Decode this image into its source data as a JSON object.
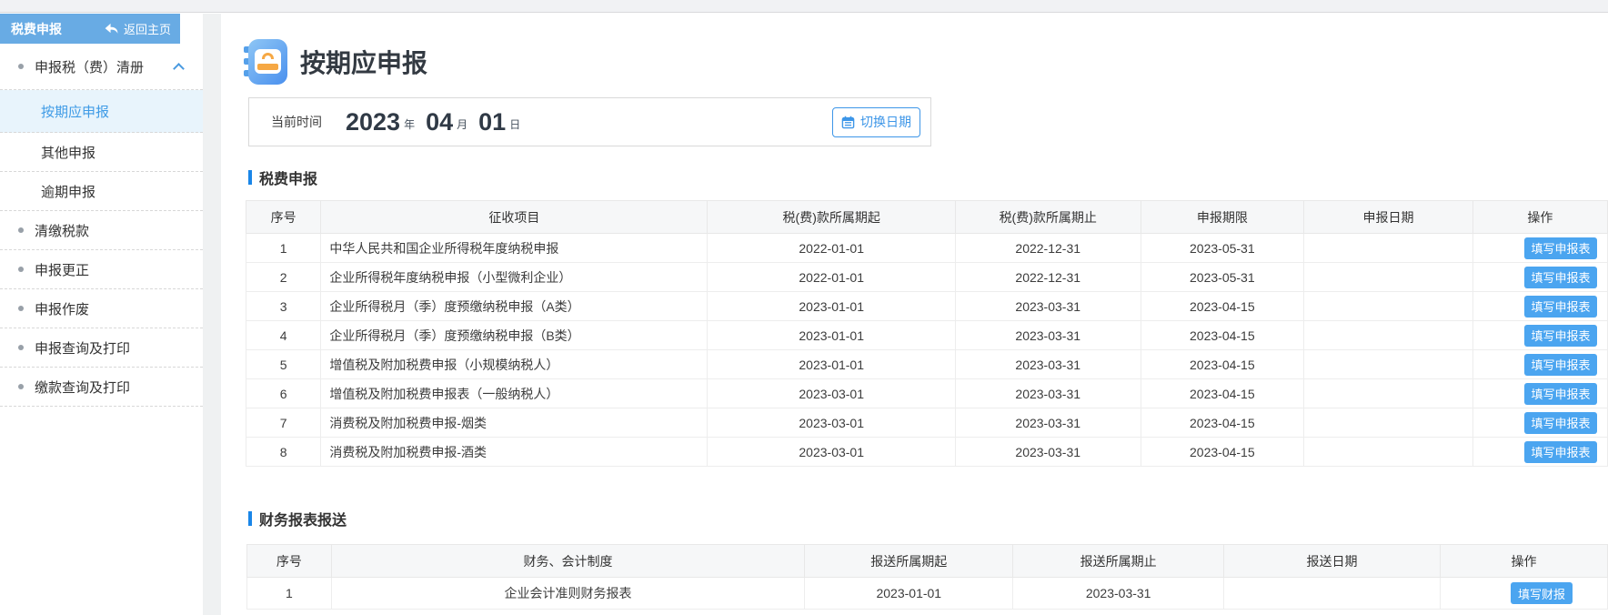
{
  "sidebar": {
    "header": {
      "title": "税费申报",
      "back_label": "返回主页"
    },
    "items": [
      {
        "type": "parent",
        "label": "申报税（费）清册",
        "expanded": true
      },
      {
        "type": "sub",
        "label": "按期应申报",
        "active": true
      },
      {
        "type": "sub",
        "label": "其他申报"
      },
      {
        "type": "sub",
        "label": "逾期申报"
      },
      {
        "type": "parent",
        "label": "清缴税款"
      },
      {
        "type": "parent",
        "label": "申报更正"
      },
      {
        "type": "parent",
        "label": "申报作废"
      },
      {
        "type": "parent",
        "label": "申报查询及打印"
      },
      {
        "type": "parent",
        "label": "缴款查询及打印"
      }
    ]
  },
  "main": {
    "page_title": "按期应申报",
    "date_bar": {
      "label": "当前时间",
      "year": "2023",
      "year_unit": "年",
      "month": "04",
      "month_unit": "月",
      "day": "01",
      "day_unit": "日",
      "switch_button": "切换日期"
    },
    "tax_table": {
      "section_title": "税费申报",
      "columns": [
        "序号",
        "征收项目",
        "税(费)款所属期起",
        "税(费)款所属期止",
        "申报期限",
        "申报日期",
        "操作"
      ],
      "action_label": "填写申报表",
      "rows": [
        {
          "no": "1",
          "project": "中华人民共和国企业所得税年度纳税申报",
          "start": "2022-01-01",
          "end": "2022-12-31",
          "deadline": "2023-05-31",
          "date": ""
        },
        {
          "no": "2",
          "project": "企业所得税年度纳税申报（小型微利企业）",
          "start": "2022-01-01",
          "end": "2022-12-31",
          "deadline": "2023-05-31",
          "date": ""
        },
        {
          "no": "3",
          "project": "企业所得税月（季）度预缴纳税申报（A类）",
          "start": "2023-01-01",
          "end": "2023-03-31",
          "deadline": "2023-04-15",
          "date": ""
        },
        {
          "no": "4",
          "project": "企业所得税月（季）度预缴纳税申报（B类）",
          "start": "2023-01-01",
          "end": "2023-03-31",
          "deadline": "2023-04-15",
          "date": ""
        },
        {
          "no": "5",
          "project": "增值税及附加税费申报（小规模纳税人）",
          "start": "2023-01-01",
          "end": "2023-03-31",
          "deadline": "2023-04-15",
          "date": ""
        },
        {
          "no": "6",
          "project": "增值税及附加税费申报表（一般纳税人）",
          "start": "2023-03-01",
          "end": "2023-03-31",
          "deadline": "2023-04-15",
          "date": ""
        },
        {
          "no": "7",
          "project": "消费税及附加税费申报-烟类",
          "start": "2023-03-01",
          "end": "2023-03-31",
          "deadline": "2023-04-15",
          "date": ""
        },
        {
          "no": "8",
          "project": "消费税及附加税费申报-酒类",
          "start": "2023-03-01",
          "end": "2023-03-31",
          "deadline": "2023-04-15",
          "date": ""
        }
      ]
    },
    "finance_table": {
      "section_title": "财务报表报送",
      "columns": [
        "序号",
        "财务、会计制度",
        "报送所属期起",
        "报送所属期止",
        "报送日期",
        "操作"
      ],
      "action_label": "填写财报",
      "rows": [
        {
          "no": "1",
          "system": "企业会计准则财务报表",
          "start": "2023-01-01",
          "end": "2023-03-31",
          "date": ""
        }
      ]
    }
  },
  "colors": {
    "sidebar_header_bg": "#68abe4",
    "active_item_bg": "#e8f4fc",
    "active_item_text": "#3f9be6",
    "accent_blue": "#3d96e8",
    "section_bar_blue": "#1a86e8",
    "button_blue": "#4ba5f0",
    "icon_orange": "#f6a844"
  }
}
